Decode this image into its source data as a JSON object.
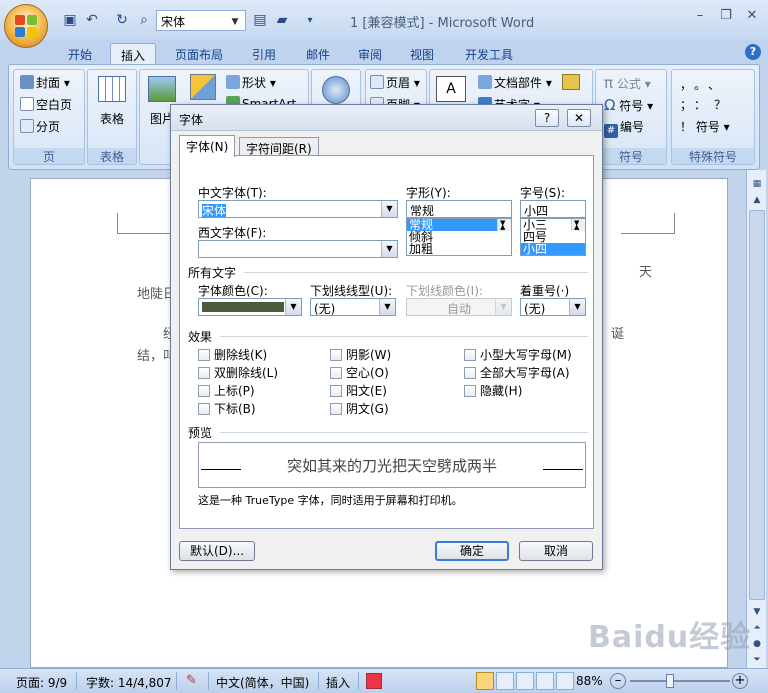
{
  "app": {
    "window_title": "1 [兼容模式] - Microsoft Word",
    "font_combo_value": "宋体"
  },
  "tabs": [
    "开始",
    "插入",
    "页面布局",
    "引用",
    "邮件",
    "审阅",
    "视图",
    "开发工具"
  ],
  "ribbon": {
    "pages_group": {
      "items": [
        "封面",
        "空白页",
        "分页"
      ],
      "label": "页"
    },
    "table_group": {
      "button": "表格",
      "label": "表格"
    },
    "illustrations": {
      "picture": "图片",
      "shapes": "形状",
      "smartart": "SmartArt"
    },
    "header_footer": {
      "header": "页眉",
      "footer": "页脚"
    },
    "text_group": {
      "quickparts": "文档部件",
      "wordart": "艺术字"
    },
    "symbols_group": {
      "formula": "公式",
      "symbol": "符号",
      "number": "编号",
      "label": "符号"
    },
    "special_group": {
      "chars": [
        "，",
        "。",
        "、",
        "；",
        "：",
        "？",
        "！"
      ],
      "symbol": "符号",
      "label": "特殊符号"
    }
  },
  "document": {
    "lines": [
      "天",
      "地陡日",
      "经",
      "诞",
      "结，叫"
    ]
  },
  "dialog": {
    "title": "字体",
    "help": "?",
    "close": "✕",
    "tabs": [
      "字体(N)",
      "字符间距(R)"
    ],
    "chinese_font_label": "中文字体(T):",
    "chinese_font_value": "宋体",
    "western_font_label": "西文字体(F):",
    "western_font_value": "",
    "style_label": "字形(Y):",
    "style_value": "常规",
    "style_options": [
      "常规",
      "倾斜",
      "加粗"
    ],
    "size_label": "字号(S):",
    "size_value": "小四",
    "size_options": [
      "小三",
      "四号",
      "小四"
    ],
    "all_text_label": "所有文字",
    "font_color_label": "字体颜色(C):",
    "font_color": "#4a5a3a",
    "underline_label": "下划线线型(U):",
    "underline_value": "(无)",
    "underline_color_label": "下划线颜色(I):",
    "underline_color_value": "自动",
    "emphasis_label": "着重号(·)",
    "emphasis_value": "(无)",
    "effects_label": "效果",
    "effects": [
      [
        "删除线(K)",
        "阴影(W)",
        "小型大写字母(M)"
      ],
      [
        "双删除线(L)",
        "空心(O)",
        "全部大写字母(A)"
      ],
      [
        "上标(P)",
        "阳文(E)",
        "隐藏(H)"
      ],
      [
        "下标(B)",
        "阴文(G)",
        ""
      ]
    ],
    "preview_label": "预览",
    "preview_text": "突如其来的刀光把天空劈成两半",
    "truetype_note": "这是一种 TrueType 字体，同时适用于屏幕和打印机。",
    "default_button": "默认(D)...",
    "ok_button": "确定",
    "cancel_button": "取消"
  },
  "status": {
    "page": "页面: 9/9",
    "words": "字数: 14/4,807",
    "language": "中文(简体，中国)",
    "mode": "插入",
    "zoom": "88%"
  },
  "watermark": "Baidu经验"
}
